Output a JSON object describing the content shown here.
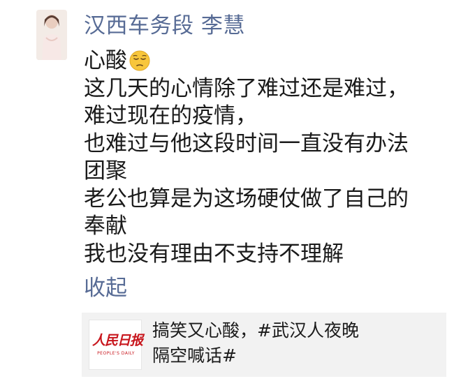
{
  "post": {
    "author": "汉西车务段 李慧",
    "avatar_icon": "profile-photo",
    "first_line": "心酸",
    "emoji_icon": "pensive-face-emoji",
    "lines": [
      "这几天的心情除了难过还是难过，",
      "难过现在的疫情，",
      "也难过与他这段时间一直没有办法",
      "团聚",
      "老公也算是为这场硬仗做了自己的",
      "奉献",
      "我也没有理由不支持不理解"
    ],
    "collapse_label": "收起"
  },
  "share": {
    "logo_text": "人民日报",
    "logo_subtext": "PEOPLE'S DAILY",
    "title_lines": [
      "搞笑又心酸，#武汉人夜晚",
      "隔空喊话#"
    ]
  },
  "colors": {
    "link": "#576b95",
    "text": "#1a1a1a",
    "card_bg": "#f2f2f2",
    "logo_red": "#c8161d"
  }
}
